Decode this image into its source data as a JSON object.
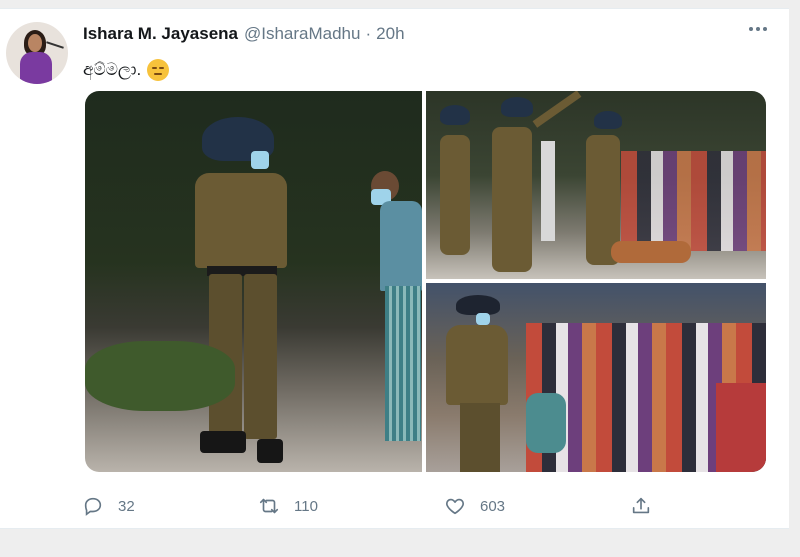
{
  "tweet": {
    "display_name": "Ishara M. Jayasena",
    "handle": "@IsharaMadhu",
    "separator": "·",
    "time": "20h",
    "text": "අම්මලා.",
    "emoji": "pensive-face"
  },
  "actions": {
    "reply_count": "32",
    "retweet_count": "110",
    "like_count": "603"
  },
  "icons": [
    "more-icon",
    "reply-icon",
    "retweet-icon",
    "like-icon",
    "share-icon"
  ],
  "colors": {
    "text_primary": "#14171a",
    "text_secondary": "#657786",
    "background": "#ffffff",
    "page_background": "#eeeeee"
  }
}
